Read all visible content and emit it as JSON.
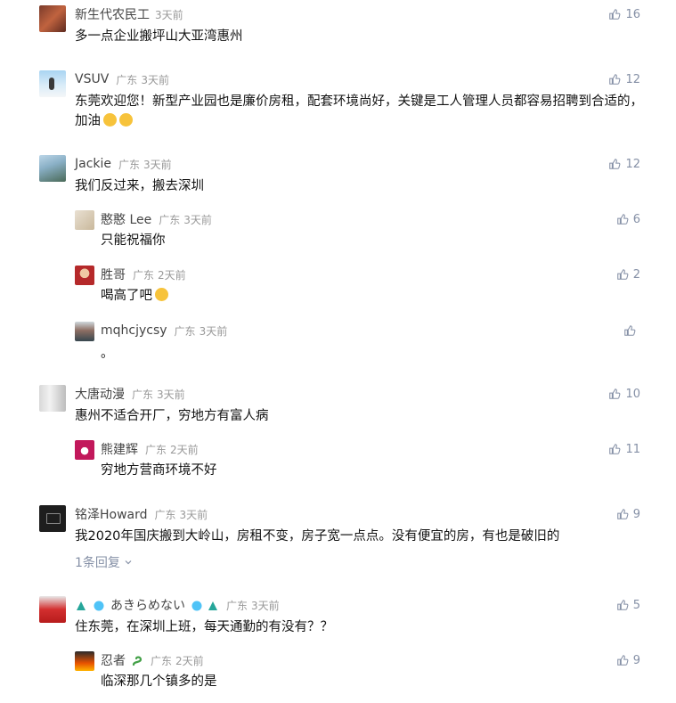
{
  "comments": [
    {
      "author": "新生代农民工",
      "region": "",
      "time": "3天前",
      "likes": "16",
      "text": "多一点企业搬坪山大亚湾惠州"
    },
    {
      "author": "VSUV",
      "region": "广东",
      "time": "3天前",
      "likes": "12",
      "text": "东莞欢迎您！新型产业园也是廉价房租，配套环境尚好，关键是工人管理人员都容易招聘到合适的，加油"
    },
    {
      "author": "Jackie",
      "region": "广东",
      "time": "3天前",
      "likes": "12",
      "text": "我们反过来，搬去深圳",
      "replies": [
        {
          "author": "憨憨 Lee",
          "region": "广东",
          "time": "3天前",
          "likes": "6",
          "text": "只能祝福你"
        },
        {
          "author": "胜哥",
          "region": "广东",
          "time": "2天前",
          "likes": "2",
          "text": "喝高了吧"
        },
        {
          "author": "mqhcjycsy",
          "region": "广东",
          "time": "3天前",
          "likes": "",
          "text": "。"
        }
      ]
    },
    {
      "author": "大唐动漫",
      "region": "广东",
      "time": "3天前",
      "likes": "10",
      "text": "惠州不适合开厂，穷地方有富人病",
      "replies": [
        {
          "author": "熊建辉",
          "region": "广东",
          "time": "2天前",
          "likes": "11",
          "text": "穷地方营商环境不好"
        }
      ]
    },
    {
      "author": "铭泽Howard",
      "region": "广东",
      "time": "3天前",
      "likes": "9",
      "text": "我2020年国庆搬到大岭山，房租不变，房子宽一点点。没有便宜的房，有也是破旧的",
      "expand_label": "1条回复"
    },
    {
      "author": "あきらめない",
      "region": "广东",
      "time": "3天前",
      "likes": "5",
      "text": "住东莞，在深圳上班，每天通勤的有没有？？",
      "replies": [
        {
          "author": "忍者",
          "region": "广东",
          "time": "2天前",
          "likes": "9",
          "text": "临深那几个镇多的是"
        }
      ]
    }
  ],
  "icon_names": {
    "like": "thumbs-up-icon",
    "chevron": "chevron-down-icon"
  },
  "colors": {
    "meta": "#999999",
    "author": "#444444",
    "like": "#8590a6",
    "text": "#121212"
  }
}
